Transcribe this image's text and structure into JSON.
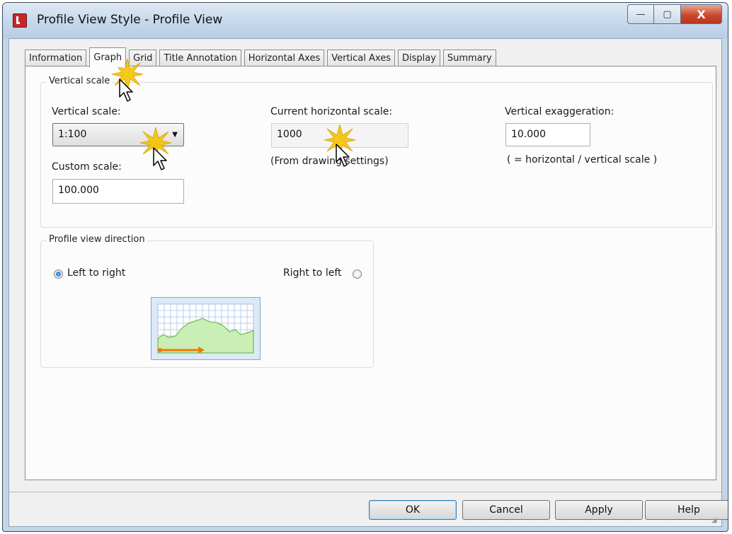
{
  "window": {
    "title": "Profile View Style - Profile View",
    "caption": {
      "minimize": "—",
      "maximize": "▢",
      "close": "X"
    }
  },
  "tabs": [
    {
      "label": "Information"
    },
    {
      "label": "Graph"
    },
    {
      "label": "Grid"
    },
    {
      "label": "Title Annotation"
    },
    {
      "label": "Horizontal Axes"
    },
    {
      "label": "Vertical Axes"
    },
    {
      "label": "Display"
    },
    {
      "label": "Summary"
    }
  ],
  "vertical_scale_group": {
    "legend": "Vertical scale",
    "vertical_scale_label": "Vertical scale:",
    "vertical_scale_value": "1:100",
    "custom_scale_label": "Custom scale:",
    "custom_scale_value": "100.000",
    "current_horizontal_scale_label": "Current horizontal scale:",
    "current_horizontal_scale_value": "1000",
    "from_drawing_settings": "(From drawing settings)",
    "vertical_exaggeration_label": "Vertical exaggeration:",
    "vertical_exaggeration_value": "10.000",
    "exaggeration_note": "( = horizontal / vertical scale )"
  },
  "direction_group": {
    "legend": "Profile view direction",
    "left_to_right": "Left to right",
    "right_to_left": "Right to left",
    "selected": "left_to_right"
  },
  "buttons": {
    "ok": "OK",
    "cancel": "Cancel",
    "apply": "Apply",
    "help": "Help"
  },
  "colors": {
    "highlight_burst": "#f5c400",
    "preview_fill": "#c9efb4",
    "arrow": "#f07800"
  }
}
